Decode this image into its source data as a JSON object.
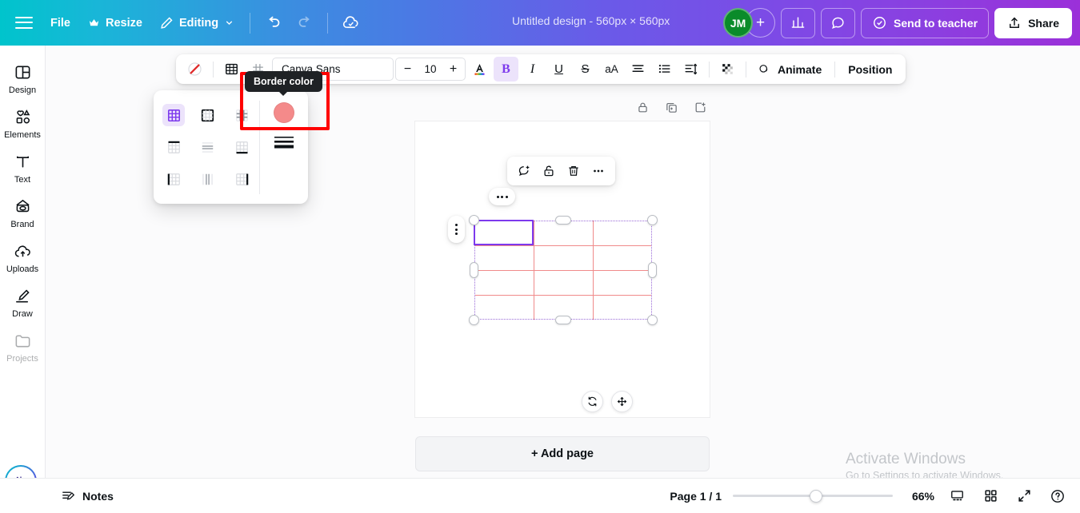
{
  "topbar": {
    "menu_icon": "hamburger-icon",
    "file_label": "File",
    "resize_label": "Resize",
    "resize_icon": "crown-icon",
    "editing_label": "Editing",
    "editing_icon": "pencil-icon",
    "chevron_icon": "chevron-down-icon",
    "undo_icon": "undo-icon",
    "redo_icon": "redo-icon",
    "cloud_icon": "cloud-check-icon",
    "title": "Untitled design - 560px × 560px",
    "avatar_initials": "JM",
    "avatar_add_label": "+",
    "insights_icon": "bar-chart-icon",
    "comment_icon": "comment-bubble-icon",
    "send_to_teacher_label": "Send to teacher",
    "send_check_icon": "check-circle-icon",
    "share_label": "Share",
    "share_icon": "upload-icon",
    "gradient_start": "#00c4cc",
    "gradient_end": "#9b30d9"
  },
  "sidebar": {
    "items": [
      {
        "label": "Design",
        "icon": "layout-icon"
      },
      {
        "label": "Elements",
        "icon": "shapes-icon"
      },
      {
        "label": "Text",
        "icon": "text-t-icon"
      },
      {
        "label": "Brand",
        "icon": "brand-badge-icon"
      },
      {
        "label": "Uploads",
        "icon": "cloud-upload-icon"
      },
      {
        "label": "Draw",
        "icon": "pen-draw-icon"
      },
      {
        "label": "Projects",
        "icon": "folder-icon"
      }
    ],
    "magic_button": "magic-sparkle-icon"
  },
  "toolbar": {
    "no_color_icon": "no-color-slash-icon",
    "table_icon": "table-grid-icon",
    "border_style_icon": "border-style-icon",
    "font_name": "Canva Sans",
    "font_size": "10",
    "size_minus": "−",
    "size_plus": "+",
    "text_color_icon": "text-color-A-icon",
    "bold_label": "B",
    "italic_label": "I",
    "underline_label": "U",
    "strike_label": "S",
    "case_label": "aA",
    "align_icon": "text-align-icon",
    "list_icon": "bullet-list-icon",
    "spacing_icon": "line-spacing-icon",
    "transparency_icon": "transparency-checker-icon",
    "animate_label": "Animate",
    "animate_icon": "animate-circle-icon",
    "position_label": "Position"
  },
  "border_dropdown": {
    "tooltip_text": "Border color",
    "highlight_color": "#ff0000",
    "swatch_color": "#f48a8a",
    "swatch_name": "border-color-swatch",
    "styles": [
      {
        "name": "all-borders",
        "selected": true
      },
      {
        "name": "outer-border",
        "selected": false
      },
      {
        "name": "inner-borders",
        "selected": false
      },
      {
        "name": "top-border",
        "selected": false
      },
      {
        "name": "horizontal-borders",
        "selected": false
      },
      {
        "name": "bottom-border",
        "selected": false
      },
      {
        "name": "left-border",
        "selected": false
      },
      {
        "name": "vertical-borders",
        "selected": false
      },
      {
        "name": "right-border",
        "selected": false
      }
    ],
    "weight_icon": "border-weight-icon"
  },
  "canvas": {
    "lock_icon": "lock-icon",
    "duplicate_icon": "duplicate-page-icon",
    "add_page_icon": "add-page-icon",
    "element_bar": {
      "comment_icon": "add-comment-icon",
      "unlock_icon": "unlock-icon",
      "delete_icon": "trash-icon",
      "more_icon": "more-dots-icon"
    },
    "cell_menu_icon": "cell-options-dots-icon",
    "row_menu_icon": "row-options-dots-icon",
    "rotate_icon": "rotate-icon",
    "move_icon": "move-arrows-icon",
    "add_page_label": "+ Add page",
    "table": {
      "columns": 3,
      "rows": 4,
      "border_color": "#f08a8a",
      "selected_cell_color": "#7d3aed",
      "selected_cell": {
        "row": 0,
        "col": 0
      },
      "selection_outline_color": "#9a6bd8"
    }
  },
  "watermark": {
    "line1": "Activate Windows",
    "line2": "Go to Settings to activate Windows."
  },
  "bottombar": {
    "notes_label": "Notes",
    "notes_icon": "notes-pencil-icon",
    "page_indicator": "Page 1 / 1",
    "zoom_value": "66%",
    "zoom_percent": 66,
    "grid_view_icon": "page-view-icon",
    "thumbnails_icon": "grid-view-icon",
    "fullscreen_icon": "expand-icon",
    "help_icon": "help-question-icon"
  }
}
